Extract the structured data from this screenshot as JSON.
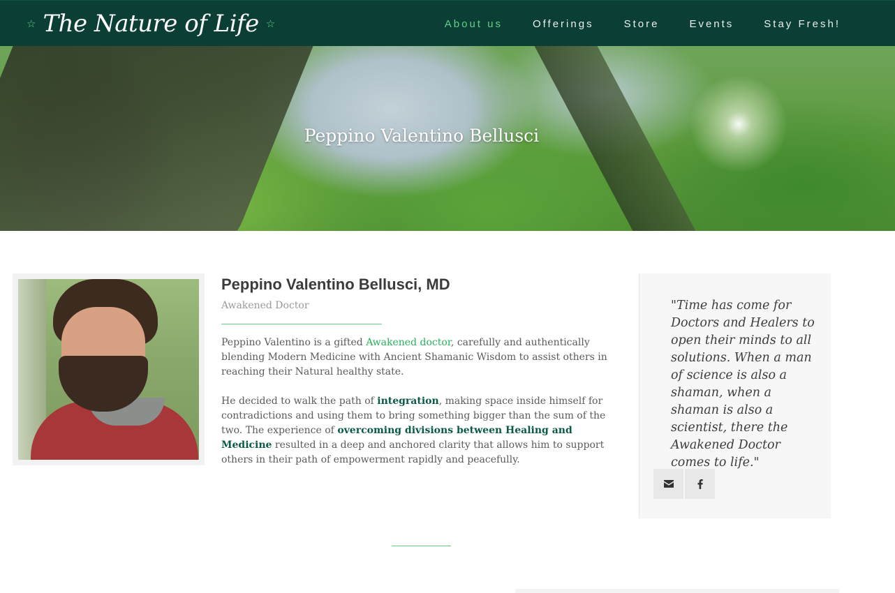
{
  "brand": {
    "logo_text": "The Nature of Life"
  },
  "nav": {
    "items": [
      {
        "label": "About us",
        "active": true
      },
      {
        "label": "Offerings"
      },
      {
        "label": "Store"
      },
      {
        "label": "Events"
      },
      {
        "label": "Stay Fresh!"
      }
    ]
  },
  "hero": {
    "title": "Peppino Valentino Bellusci"
  },
  "profile": {
    "name": "Peppino Valentino Bellusci, MD",
    "subtitle": "Awakened Doctor",
    "p1": {
      "before": "Peppino Valentino is a gifted ",
      "link": "Awakened doctor",
      "after": ", carefully and authentically blending Modern Medicine with Ancient Shamanic Wisdom to assist others in reaching their Natural healthy state."
    },
    "p2": {
      "t1": "He decided to walk the path of ",
      "b1": "integration",
      "t2": ", making space inside himself for contradictions and using them to bring something bigger than the sum of the two. The experience of ",
      "b2": "overcoming divisions between Healing and Medicine",
      "t3": " resulted in a deep and anchored clarity that allows him to support others in their path of empowerment rapidly and peacefully."
    }
  },
  "quote": {
    "text": "\"Time has come for Doctors and Healers to open their minds to all solutions. When a man of science is also a shaman, when a shaman is also a scientist, there the Awakened Doctor comes to life.\""
  },
  "social": {
    "icons": [
      "mail-icon",
      "facebook-icon"
    ]
  },
  "colors": {
    "header_bg": "#0b3f36",
    "accent": "#5fd187",
    "link": "#26b35c",
    "strong": "#0b5a48"
  }
}
